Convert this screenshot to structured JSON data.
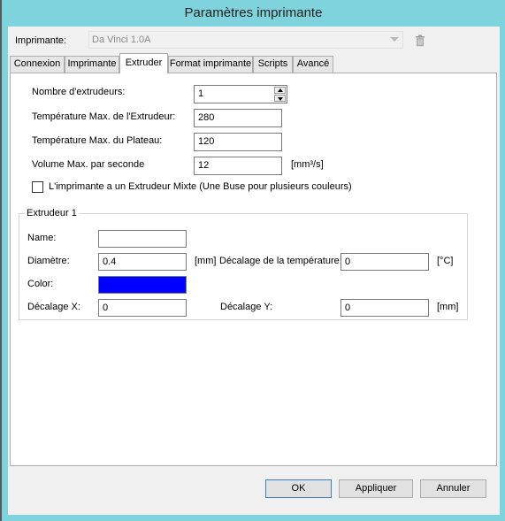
{
  "window": {
    "title": "Paramètres imprimante"
  },
  "printer": {
    "label": "Imprimante:",
    "selected": "Da Vinci 1.0A",
    "delete_icon": "trash-icon"
  },
  "tabs": [
    {
      "label": "Connexion",
      "active": false
    },
    {
      "label": "Imprimante",
      "active": false
    },
    {
      "label": "Extruder",
      "active": true
    },
    {
      "label": "Format imprimante",
      "active": false
    },
    {
      "label": "Scripts",
      "active": false
    },
    {
      "label": "Avancé",
      "active": false
    }
  ],
  "extruder": {
    "count_label": "Nombre d'extrudeurs:",
    "count_value": "1",
    "max_temp_label": "Température Max. de l'Extrudeur:",
    "max_temp_value": "280",
    "bed_temp_label": "Température Max. du Plateau:",
    "bed_temp_value": "120",
    "volume_label": "Volume Max. par seconde",
    "volume_value": "12",
    "volume_unit": "[mm³/s]",
    "mixing_label": "L'imprimante a un Extrudeur Mixte (Une Buse pour plusieurs couleurs)",
    "mixing_checked": false
  },
  "group": {
    "title": "Extrudeur 1",
    "name_label": "Name:",
    "name_value": "",
    "diameter_label": "Diamètre:",
    "diameter_value": "0.4",
    "diameter_unit": "[mm]",
    "temp_offset_label": "Décalage de la température:",
    "temp_offset_value": "0",
    "temp_offset_unit": "[°C]",
    "color_label": "Color:",
    "color_value": "#0000ff",
    "offset_x_label": "Décalage X:",
    "offset_x_value": "0",
    "offset_y_label": "Décalage Y:",
    "offset_y_value": "0",
    "offset_unit": "[mm]"
  },
  "buttons": {
    "ok": "OK",
    "apply": "Appliquer",
    "cancel": "Annuler"
  }
}
